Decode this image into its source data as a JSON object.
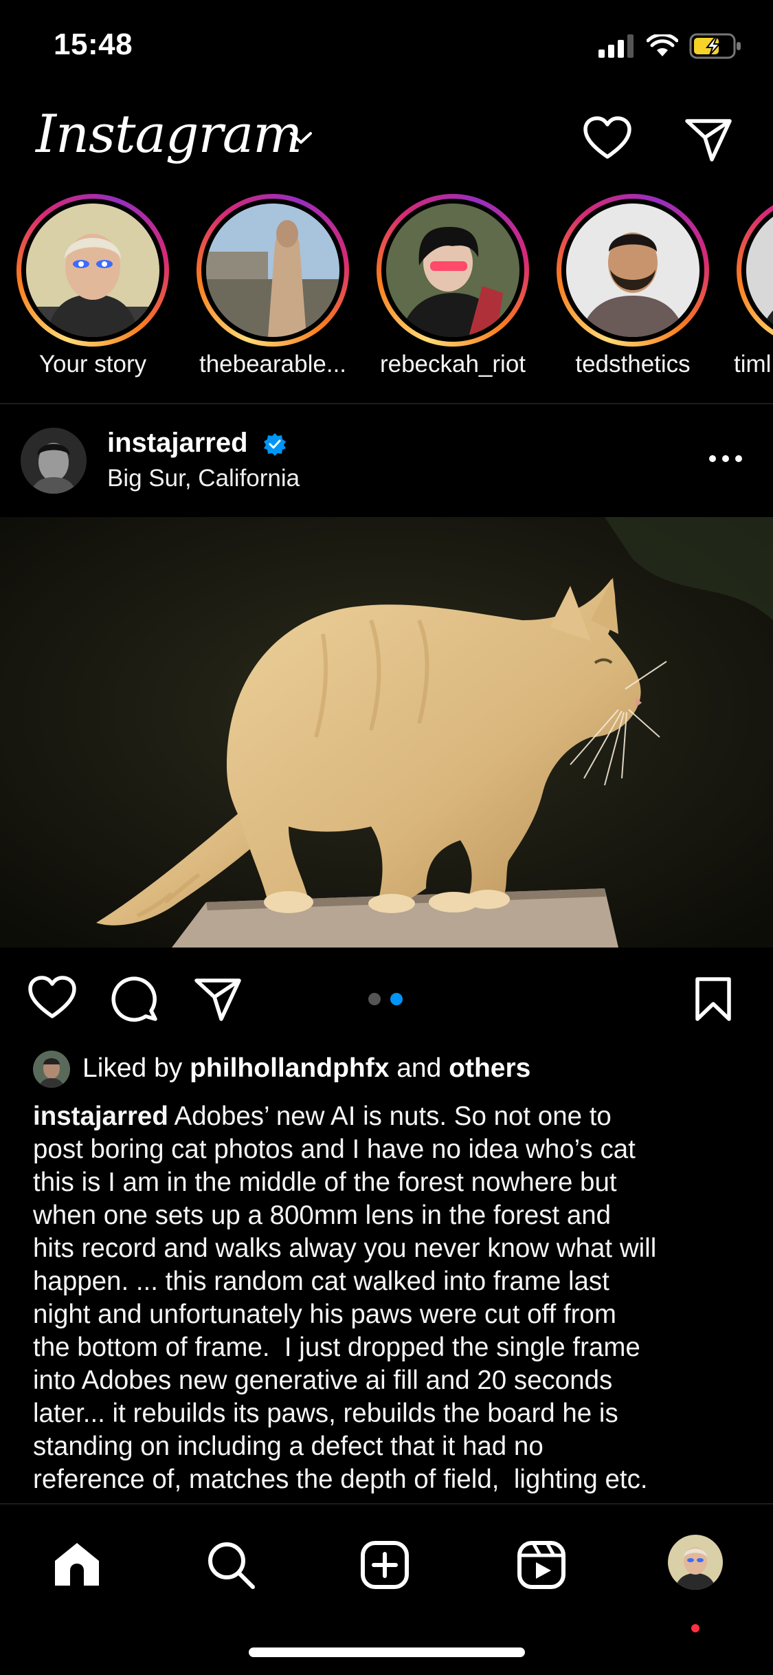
{
  "status_bar": {
    "time": "15:48"
  },
  "header": {
    "logo": "Instagram"
  },
  "stories": [
    {
      "label": "Your story"
    },
    {
      "label": "thebearable..."
    },
    {
      "label": "rebeckah_riot"
    },
    {
      "label": "tedsthetics"
    },
    {
      "label": "timl"
    }
  ],
  "post": {
    "username": "instajarred",
    "location": "Big Sur, California",
    "carousel": {
      "count": 2,
      "active": 2
    },
    "likes": {
      "prefix": "Liked by ",
      "user": "philhollandphfx",
      "middle": " and ",
      "suffix": "others"
    },
    "caption": {
      "username": "instajarred",
      "lines": [
        " Adobes’ new AI is nuts. So not one to",
        "post boring cat photos and I have no idea who’s cat",
        "this is I am in the middle of the forest nowhere but",
        "when one sets up a 800mm lens in the forest and",
        "hits record and walks alway you never know what will",
        "happen. ... this random cat walked into frame last",
        "night and unfortunately his paws were cut off from",
        "the bottom of frame.  I just dropped the single frame",
        "into Adobes new generative ai fill and 20 seconds",
        "later... it rebuilds its paws, rebuilds the board he is",
        "standing on including a defect that it had no",
        "reference of, matches the depth of field,  lighting etc."
      ]
    }
  },
  "icons": {
    "notifications": "heart-icon",
    "direct": "paper-plane-icon",
    "like": "heart-icon",
    "comment": "speech-bubble-icon",
    "share": "paper-plane-icon",
    "save": "bookmark-icon",
    "more": "ellipsis-icon",
    "verified": "verified-badge-icon",
    "nav": [
      "home-icon",
      "search-icon",
      "plus-square-icon",
      "reels-icon",
      "profile-avatar"
    ]
  },
  "colors": {
    "accent": "#0095f6",
    "background": "#000000",
    "notification_dot": "#ff3040"
  }
}
